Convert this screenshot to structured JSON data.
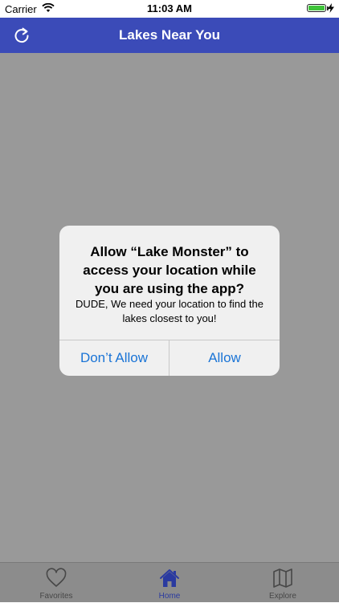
{
  "status_bar": {
    "carrier": "Carrier",
    "time": "11:03 AM",
    "icons": [
      "wifi-icon",
      "battery-icon",
      "charging-icon"
    ],
    "battery_color": "#3fc33a"
  },
  "nav": {
    "title": "Lakes Near You",
    "left_icon": "refresh-icon",
    "background_color": "#3b4bb8"
  },
  "alert": {
    "title": "Allow “Lake Monster” to access your location while you are using the app?",
    "message": "DUDE, We need your location to find the lakes closest to you!",
    "buttons": {
      "deny": "Don’t Allow",
      "allow": "Allow"
    },
    "button_color": "#1a74d6"
  },
  "tabs": [
    {
      "label": "Favorites",
      "icon": "heart-icon",
      "active": false
    },
    {
      "label": "Home",
      "icon": "house-icon",
      "active": true
    },
    {
      "label": "Explore",
      "icon": "map-icon",
      "active": false
    }
  ]
}
